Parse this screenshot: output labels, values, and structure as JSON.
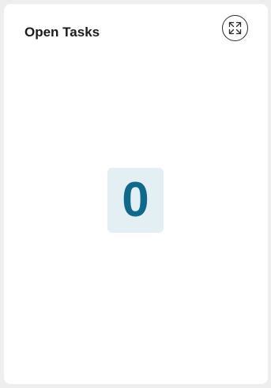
{
  "card": {
    "title": "Open Tasks",
    "expand_icon": "expand-arrows-icon",
    "count": "0"
  },
  "colors": {
    "page_background": "#eeeeee",
    "card_background": "#ffffff",
    "title_text": "#1b1b1b",
    "count_background": "#e3eff3",
    "count_text": "#0d6a8c"
  }
}
